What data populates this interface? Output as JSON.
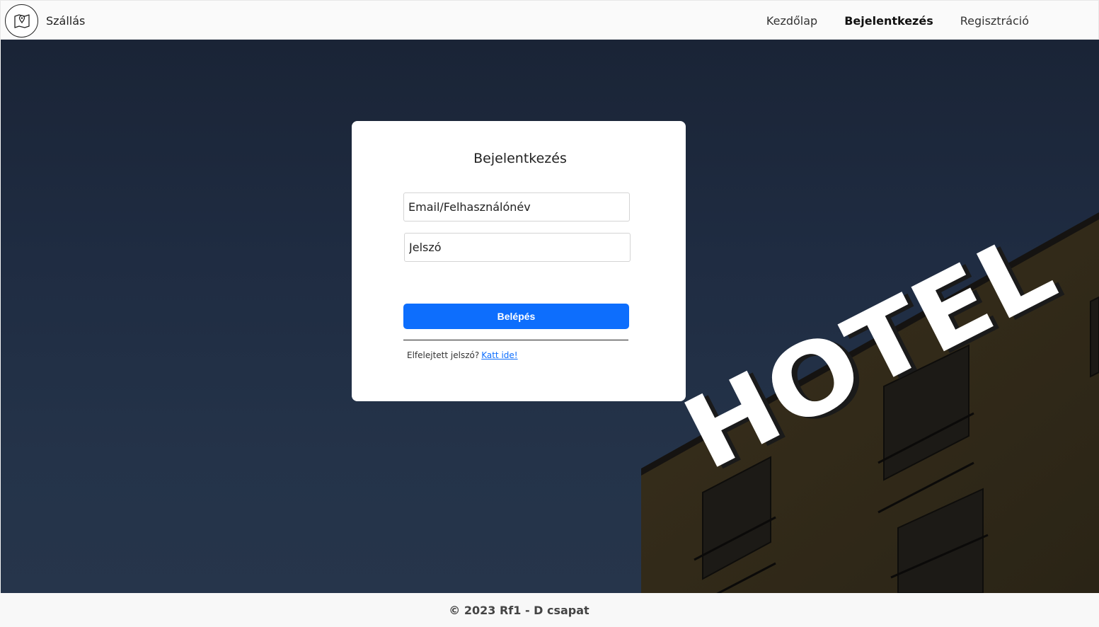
{
  "brand": {
    "name": "Szállás",
    "icon": "map-pin-icon"
  },
  "nav": {
    "items": [
      {
        "label": "Kezdőlap",
        "active": false
      },
      {
        "label": "Bejelentkezés",
        "active": true
      },
      {
        "label": "Regisztráció",
        "active": false
      }
    ]
  },
  "hero": {
    "sign_text": "HOTEL"
  },
  "login": {
    "title": "Bejelentkezés",
    "email_placeholder": "Email/Felhasználónév",
    "email_value": "",
    "password_placeholder": "Jelszó",
    "password_value": "",
    "submit_label": "Belépés",
    "forgot_text": "Elfelejtett jelszó?",
    "forgot_link": "Katt ide!"
  },
  "footer": {
    "text": "© 2023 Rf1 - D csapat"
  },
  "colors": {
    "primary": "#0d6efd",
    "sky": "#1f2c42",
    "building": "#2e2718"
  }
}
